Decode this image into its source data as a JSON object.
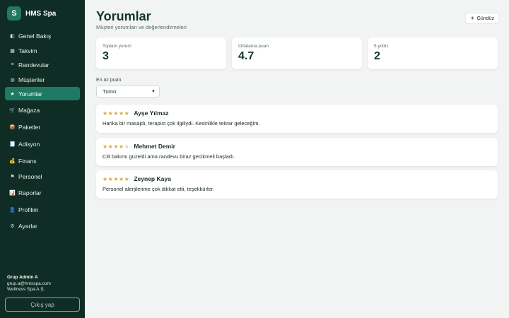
{
  "brand": {
    "logo_letter": "S",
    "name": "HMS Spa"
  },
  "nav": [
    {
      "label": "Genel Bakış",
      "icon": "dashboard-icon",
      "glyph": "◧",
      "active": false
    },
    {
      "label": "Takvim",
      "icon": "calendar-icon",
      "glyph": "▦",
      "active": false
    },
    {
      "label": "Randevular",
      "icon": "list-icon",
      "glyph": "≡",
      "active": false
    },
    {
      "label": "Müşteriler",
      "icon": "customers-icon",
      "glyph": "◍",
      "active": false
    },
    {
      "label": "Yorumlar",
      "icon": "star-icon",
      "glyph": "★",
      "active": true
    },
    {
      "label": "Mağaza",
      "icon": "cart-icon",
      "glyph": "🛒",
      "active": false
    },
    {
      "label": "Paketler",
      "icon": "package-icon",
      "glyph": "📦",
      "active": false
    },
    {
      "label": "Adisyon",
      "icon": "receipt-icon",
      "glyph": "🧾",
      "active": false
    },
    {
      "label": "Finans",
      "icon": "money-bag-icon",
      "glyph": "💰",
      "active": false
    },
    {
      "label": "Personel",
      "icon": "flag-icon",
      "glyph": "⚑",
      "active": false
    },
    {
      "label": "Raporlar",
      "icon": "chart-icon",
      "glyph": "📊",
      "active": false
    },
    {
      "label": "Profilim",
      "icon": "profile-icon",
      "glyph": "👤",
      "active": false
    },
    {
      "label": "Ayarlar",
      "icon": "gear-icon",
      "glyph": "⚙",
      "active": false
    }
  ],
  "user": {
    "name": "Grup Admin A",
    "email": "grup.a@hmsspa.com",
    "company": "Wellness Spa A.Ş."
  },
  "logout_label": "Çıkış yap",
  "header": {
    "title": "Yorumlar",
    "subtitle": "Müşteri yorumları ve değerlendirmeleri",
    "theme_label": "Gündüz",
    "theme_icon": "sun-icon"
  },
  "stats": [
    {
      "label": "Toplam yorum",
      "value": "3"
    },
    {
      "label": "Ortalama puan",
      "value": "4.7"
    },
    {
      "label": "5 yıldız",
      "value": "2"
    }
  ],
  "filter": {
    "label": "En az puan",
    "selected": "Tümü"
  },
  "reviews": [
    {
      "name": "Ayşe Yılmaz",
      "rating": 5,
      "text": "Harika bir masajdı, terapist çok ilgiliydi. Kesinlikle tekrar geleceğim."
    },
    {
      "name": "Mehmet Demir",
      "rating": 4,
      "text": "Cilt bakımı güzeldi ama randevu biraz gecikmeli başladı."
    },
    {
      "name": "Zeynep Kaya",
      "rating": 5,
      "text": "Personel alerjilerime çok dikkat etti, teşekkürler."
    }
  ],
  "colors": {
    "sidebar_bg": "#0f2d25",
    "accent": "#1f7a63",
    "star": "#d9a845",
    "page_bg": "#f2f4f3"
  }
}
